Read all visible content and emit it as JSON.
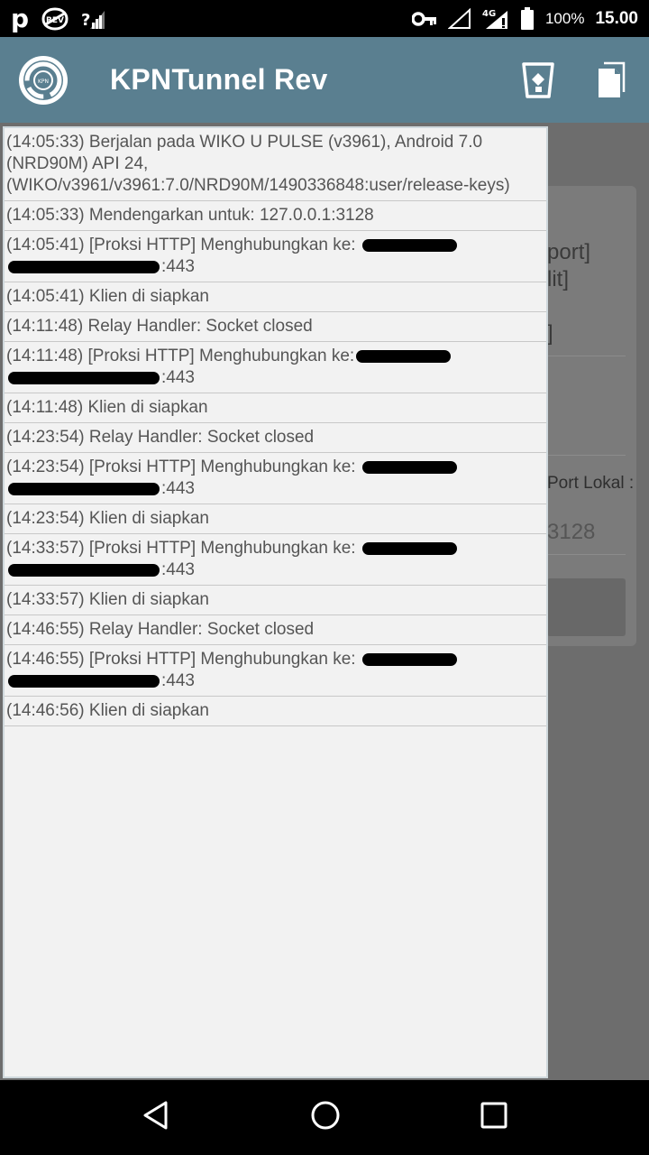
{
  "status_bar": {
    "battery_percent": "100%",
    "time": "15.00",
    "network_label": "4G",
    "p_label": "p",
    "rev_label": "REV"
  },
  "app_bar": {
    "title": "KPNTunnel Rev",
    "logo_label": "KPN",
    "color": "#5a7f90"
  },
  "background": {
    "text_port": "port]",
    "text_lit": "lit]",
    "text_bracket": "]",
    "port_lokal_label": "Port Lokal :",
    "port_value": "3128"
  },
  "log": [
    {
      "prefix": "(14:05:33) Berjalan pada WIKO U PULSE (v3961), Android 7.0 (NRD90M) API 24, (WIKO/v3961/v3961:7.0/NRD90M/1490336848:user/release-keys)",
      "redacted": false,
      "suffix": ""
    },
    {
      "prefix": "(14:05:33) Mendengarkan untuk: 127.0.0.1:3128",
      "redacted": false,
      "suffix": ""
    },
    {
      "prefix": "(14:05:41) [Proksi HTTP] Menghubungkan ke: ",
      "redacted": true,
      "suffix": ":443"
    },
    {
      "prefix": "(14:05:41) Klien di siapkan",
      "redacted": false,
      "suffix": ""
    },
    {
      "prefix": "(14:11:48) Relay Handler: Socket closed",
      "redacted": false,
      "suffix": ""
    },
    {
      "prefix": "(14:11:48) [Proksi HTTP] Menghubungkan ke:",
      "redacted": true,
      "suffix": ":443"
    },
    {
      "prefix": "(14:11:48) Klien di siapkan",
      "redacted": false,
      "suffix": ""
    },
    {
      "prefix": "(14:23:54) Relay Handler: Socket closed",
      "redacted": false,
      "suffix": ""
    },
    {
      "prefix": "(14:23:54) [Proksi HTTP] Menghubungkan ke: ",
      "redacted": true,
      "suffix": ":443"
    },
    {
      "prefix": "(14:23:54) Klien di siapkan",
      "redacted": false,
      "suffix": ""
    },
    {
      "prefix": "(14:33:57) [Proksi HTTP] Menghubungkan ke: ",
      "redacted": true,
      "suffix": ":443"
    },
    {
      "prefix": "(14:33:57) Klien di siapkan",
      "redacted": false,
      "suffix": ""
    },
    {
      "prefix": "(14:46:55) Relay Handler: Socket closed",
      "redacted": false,
      "suffix": ""
    },
    {
      "prefix": "(14:46:55) [Proksi HTTP] Menghubungkan ke: ",
      "redacted": true,
      "suffix": ":443"
    },
    {
      "prefix": "(14:46:56) Klien di siapkan",
      "redacted": false,
      "suffix": ""
    }
  ],
  "icons": {
    "status_left": [
      "p-icon",
      "rev-icon",
      "no-signal-icon"
    ],
    "status_right": [
      "key-icon",
      "signal-icon",
      "signal-4g-icon",
      "battery-icon"
    ],
    "app_bar_actions": [
      "clear-log-icon",
      "copy-log-icon"
    ],
    "nav": [
      "back-icon",
      "home-icon",
      "recents-icon"
    ]
  }
}
